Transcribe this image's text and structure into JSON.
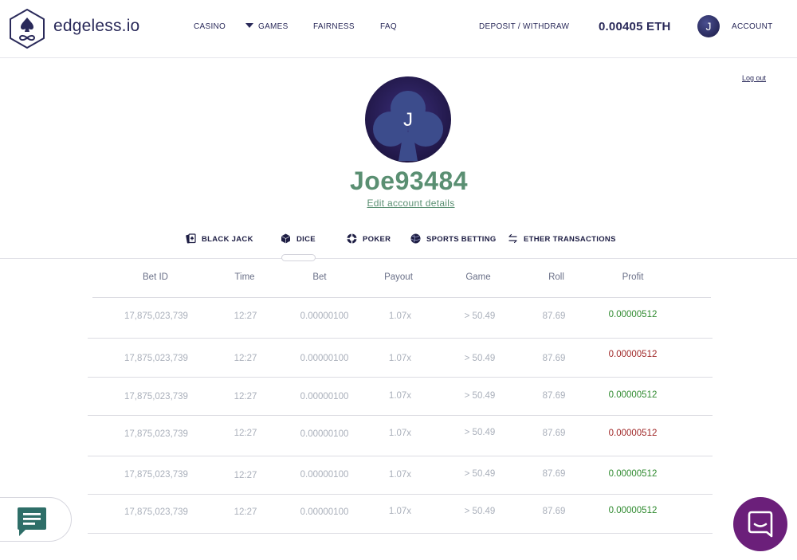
{
  "header": {
    "brand": "edgeless.io",
    "nav": {
      "casino": "CASINO",
      "games": "GAMES",
      "fairness": "FAIRNESS",
      "faq": "FAQ",
      "deposit": "DEPOSIT / WITHDRAW",
      "account": "ACCOUNT"
    },
    "balance": "0.00405 ETH",
    "avatar_initial": "J"
  },
  "logout": "Log out",
  "profile": {
    "initial": "J",
    "username": "Joe93484",
    "edit_link": "Edit account details"
  },
  "tabs": [
    {
      "label": "BLACK JACK",
      "icon": "blackjack-cards-icon"
    },
    {
      "label": "DICE",
      "icon": "dice-icon",
      "active": true
    },
    {
      "label": "POKER",
      "icon": "poker-chip-icon"
    },
    {
      "label": "SPORTS BETTING",
      "icon": "ball-icon"
    },
    {
      "label": "ETHER TRANSACTIONS",
      "icon": "transfer-arrows-icon"
    }
  ],
  "table": {
    "columns": [
      "Bet  ID",
      "Time",
      "Bet",
      "Payout",
      "Game",
      "Roll",
      "Profit"
    ],
    "rows": [
      {
        "bet_id": "17,875,023,739",
        "time": "12:27",
        "bet": "0.00000100",
        "payout": "1.07x",
        "game": "> 50.49",
        "roll": "87.69",
        "profit": "0.00000512",
        "profit_sign": "positive"
      },
      {
        "bet_id": "17,875,023,739",
        "time": "12:27",
        "bet": "0.00000100",
        "payout": "1.07x",
        "game": "> 50.49",
        "roll": "87.69",
        "profit": "0.00000512",
        "profit_sign": "negative"
      },
      {
        "bet_id": "17,875,023,739",
        "time": "12:27",
        "bet": "0.00000100",
        "payout": "1.07x",
        "game": "> 50.49",
        "roll": "87.69",
        "profit": "0.00000512",
        "profit_sign": "positive"
      },
      {
        "bet_id": "17,875,023,739",
        "time": "12:27",
        "bet": "0.00000100",
        "payout": "1.07x",
        "game": "> 50.49",
        "roll": "87.69",
        "profit": "0.00000512",
        "profit_sign": "negative"
      },
      {
        "bet_id": "17,875,023,739",
        "time": "12:27",
        "bet": "0.00000100",
        "payout": "1.07x",
        "game": "> 50.49",
        "roll": "87.69",
        "profit": "0.00000512",
        "profit_sign": "positive"
      },
      {
        "bet_id": "17,875,023,739",
        "time": "12:27",
        "bet": "0.00000100",
        "payout": "1.07x",
        "game": "> 50.49",
        "roll": "87.69",
        "profit": "0.00000512",
        "profit_sign": "positive"
      }
    ]
  },
  "colors": {
    "brand_navy": "#2a2a5a",
    "username_green": "#5a8f72",
    "profit_positive": "#2f8a2f",
    "profit_negative": "#a02828",
    "support_purple": "#6b1f7a",
    "chat_teal": "#2e6e68"
  },
  "widgets": {
    "chat_icon": "chat-bubble-icon",
    "support_icon": "support-chat-icon"
  }
}
